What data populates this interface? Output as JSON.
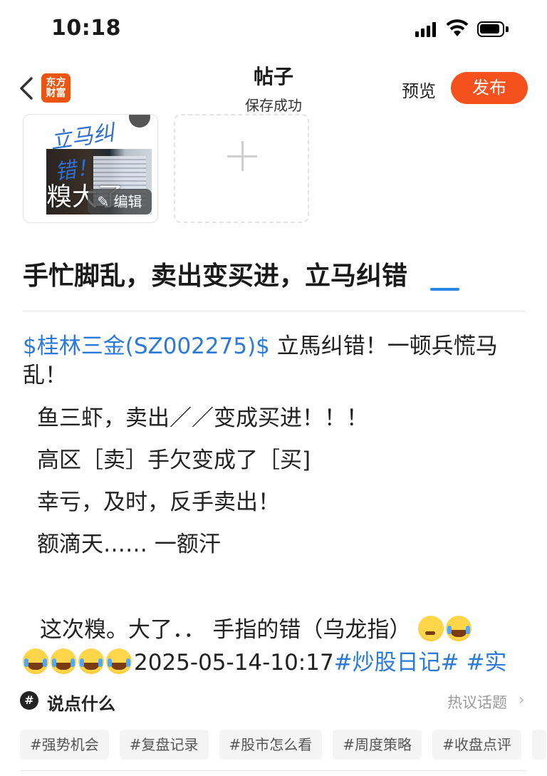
{
  "status_bar": {
    "time": "10:18"
  },
  "nav": {
    "back_icon": "chevron-left-icon",
    "logo_line1": "东方",
    "logo_line2": "财富",
    "title": "帖子",
    "subtitle": "保存成功",
    "preview_label": "预览",
    "publish_label": "发布",
    "accent_color": "#f4511e"
  },
  "images": {
    "thumb_scrawl": "立马纠错！",
    "thumb_big_text": "糗大了",
    "edit_label": "编辑"
  },
  "post": {
    "title": "手忙脚乱，卖出变买进，立马纠错",
    "stock_tag": "$桂林三金(SZ002275)$",
    "first_line_rest": "  立馬纠错！一顿兵慌马乱！",
    "lines": [
      "鱼三虾，卖出／／变成买进！！！",
      "高区［卖］手欠变成了［买]",
      "幸亏，及时，反手卖出！",
      "额滴天…… 一额汗"
    ],
    "closing": "这次糗。大了．．  手指的错（乌龙指）",
    "timestamp": "2025-05-14-10:17",
    "topic1": "#炒股日记#",
    "topic2": "#实",
    "link_color": "#2b7ad9"
  },
  "bottom": {
    "say_label": "说点什么",
    "hot_topics_label": "热议话题",
    "tags": [
      "#强势机会",
      "#复盘记录",
      "#股市怎么看",
      "#周度策略",
      "#收盘点评"
    ]
  }
}
